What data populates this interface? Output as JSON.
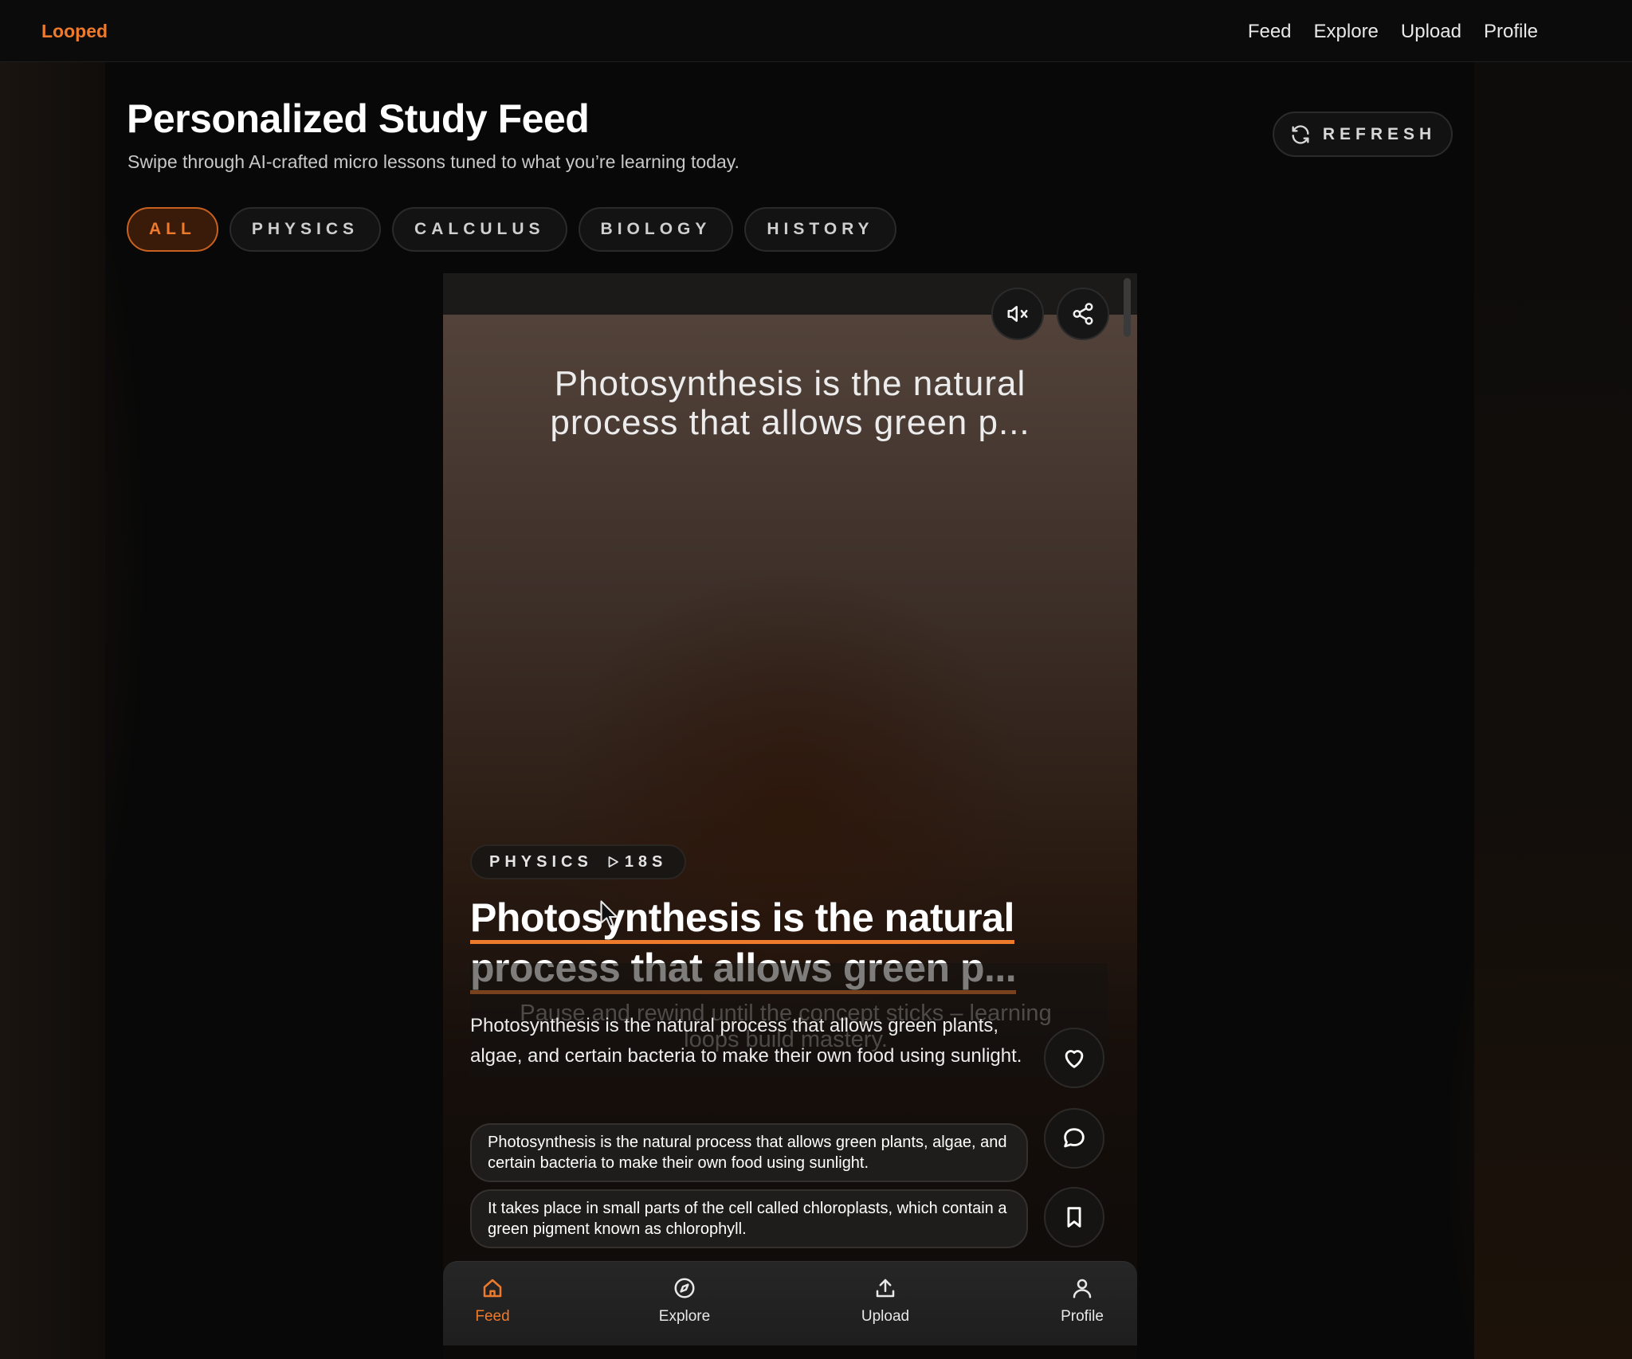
{
  "app": {
    "brand": "Looped"
  },
  "topnav": {
    "items": [
      "Feed",
      "Explore",
      "Upload",
      "Profile"
    ]
  },
  "header": {
    "title": "Personalized Study Feed",
    "subtitle": "Swipe through AI-crafted micro lessons tuned to what you’re learning today.",
    "refresh_label": "REFRESH"
  },
  "filters": {
    "items": [
      "ALL",
      "PHYSICS",
      "CALCULUS",
      "BIOLOGY",
      "HISTORY"
    ],
    "active": "ALL"
  },
  "card": {
    "caption": "Photosynthesis is the natural process that allows green p...",
    "category": "PHYSICS",
    "duration": "18S",
    "title_line1": "Photosynthesis is the natural",
    "title_line2": "process that allows green p...",
    "ghost_caption": "Pause and rewind until the concept sticks – learning loops build mastery.",
    "description": "Photosynthesis is the natural process that allows green plants, algae, and certain bacteria to make their own food using sunlight.",
    "bullets": [
      "Photosynthesis is the natural process that allows green plants, algae, and certain bacteria to make their own food using sunlight.",
      "It takes place in small parts of the cell called chloroplasts, which contain a green pigment known as chlorophyll."
    ]
  },
  "tabbar": {
    "items": [
      "Feed",
      "Explore",
      "Upload",
      "Profile"
    ],
    "active": "Feed"
  },
  "colors": {
    "accent": "#ee7a2c",
    "background": "#080808",
    "chip_active_bg": "#3a1a08"
  },
  "icons": {
    "refresh": "refresh-icon",
    "mute": "mute-icon",
    "share": "share-icon",
    "play": "play-icon",
    "like": "heart-icon",
    "comment": "comment-icon",
    "save": "bookmark-icon",
    "feed": "home-icon",
    "explore": "compass-icon",
    "upload": "upload-icon",
    "profile": "user-icon"
  }
}
